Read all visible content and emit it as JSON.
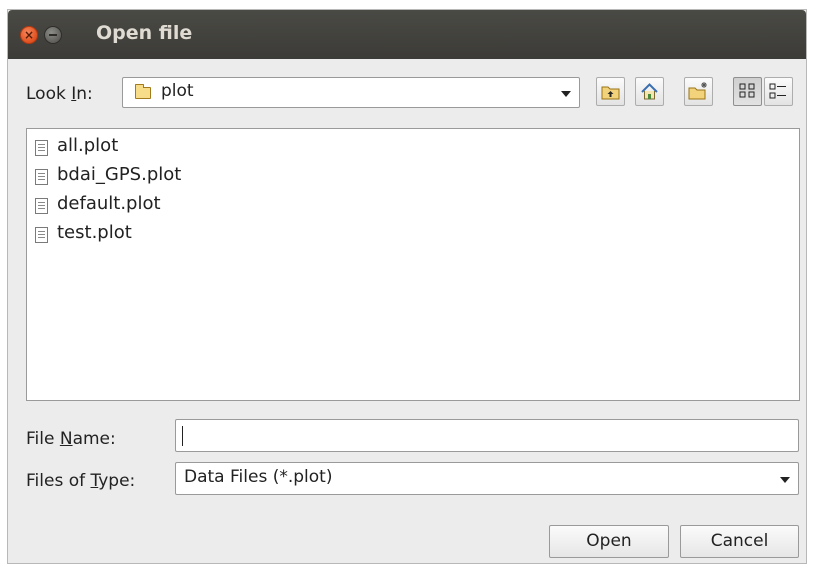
{
  "window": {
    "title": "Open file",
    "close_glyph": "×"
  },
  "look_in": {
    "label_pre": "Look ",
    "label_mn": "I",
    "label_post": "n:",
    "value": "plot",
    "icon": "folder-icon"
  },
  "toolbar": {
    "buttons": [
      "up-one-level-icon",
      "home-icon",
      "create-new-folder-icon",
      "list-view-icon",
      "details-view-icon"
    ],
    "selected": "list-view-icon"
  },
  "files": [
    {
      "name": "all.plot"
    },
    {
      "name": "bdai_GPS.plot"
    },
    {
      "name": "default.plot"
    },
    {
      "name": "test.plot"
    }
  ],
  "file_name": {
    "label_pre": "File ",
    "label_mn": "N",
    "label_post": "ame:",
    "value": ""
  },
  "file_type": {
    "label_pre": "Files of ",
    "label_mn": "T",
    "label_post": "ype:",
    "value": "Data Files (*.plot)"
  },
  "buttons": {
    "open": "Open",
    "cancel": "Cancel"
  },
  "colors": {
    "titlebar": "#3c3b37",
    "close_button": "#e0501f",
    "folder": "#f7dd8a"
  }
}
